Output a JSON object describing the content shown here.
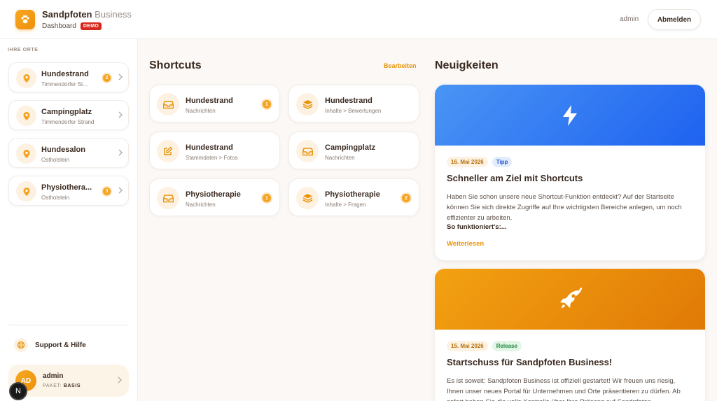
{
  "header": {
    "brand_main": "Sandpfoten",
    "brand_sub": "Business",
    "section": "Dashboard",
    "demo_badge": "DEMO",
    "username": "admin",
    "logout_label": "Abmelden"
  },
  "sidebar": {
    "heading": "IHRE ORTE",
    "places": [
      {
        "name": "Hundestrand",
        "location": "Timmendorfer St...",
        "badge": "2"
      },
      {
        "name": "Campingplatz",
        "location": "Timmendorfer Strand",
        "badge": ""
      },
      {
        "name": "Hundesalon",
        "location": "Ostholstein",
        "badge": ""
      },
      {
        "name": "Physiothera...",
        "location": "Ostholstein",
        "badge": "3"
      }
    ],
    "support_label": "Support & Hilfe",
    "user": {
      "initials": "AD",
      "name": "admin",
      "plan_label": "PAKET:",
      "plan": "BASIS"
    }
  },
  "shortcuts": {
    "title": "Shortcuts",
    "edit_label": "Bearbeiten",
    "items": [
      {
        "title": "Hundestrand",
        "subtitle": "Nachrichten",
        "badge": "1",
        "icon": "inbox-icon"
      },
      {
        "title": "Hundestrand",
        "subtitle": "Inhalte > Bewertungen",
        "badge": "",
        "icon": "layers-icon"
      },
      {
        "title": "Hundestrand",
        "subtitle": "Stammdaten > Fotos",
        "badge": "",
        "icon": "edit-icon"
      },
      {
        "title": "Campingplatz",
        "subtitle": "Nachrichten",
        "badge": "",
        "icon": "inbox-icon"
      },
      {
        "title": "Physiotherapie",
        "subtitle": "Nachrichten",
        "badge": "1",
        "icon": "inbox-icon"
      },
      {
        "title": "Physiotherapie",
        "subtitle": "Inhalte > Fragen",
        "badge": "2",
        "icon": "layers-icon"
      }
    ]
  },
  "news": {
    "title": "Neuigkeiten",
    "items": [
      {
        "date": "16. Mai 2026",
        "tag": "Tipp",
        "headline": "Schneller am Ziel mit Shortcuts",
        "text": "Haben Sie schon unsere neue Shortcut-Funktion entdeckt? Auf der Startseite können Sie sich direkte Zugriffe auf Ihre wichtigsten Bereiche anlegen, um noch effizienter zu arbeiten.",
        "subheading": "So funktioniert's:...",
        "more_label": "Weiterlesen",
        "icon": "lightning-icon",
        "colors": {
          "banner_from": "#4a95f5",
          "banner_to": "#1e62f0",
          "tag_bg": "#e3ecfd",
          "tag_fg": "#2257d6"
        }
      },
      {
        "date": "15. Mai 2026",
        "tag": "Release",
        "headline": "Startschuss für Sandpfoten Business!",
        "text": "Es ist soweit: Sandpfoten Business ist offiziell gestartet! Wir freuen uns riesig, Ihnen unser neues Portal für Unternehmen und Orte präsentieren zu dürfen. Ab sofort haben Sie die volle Kontrolle über Ihre Präsenz auf Sandpfoten.",
        "icon": "rocket-icon",
        "colors": {
          "banner_from": "#f3a112",
          "banner_to": "#e07a06",
          "tag_bg": "#e2f5e7",
          "tag_fg": "#1f8a3e"
        }
      }
    ]
  },
  "colors": {
    "accent": "#f5a320",
    "text": "#3a2a20",
    "background": "#fbf8f5"
  }
}
